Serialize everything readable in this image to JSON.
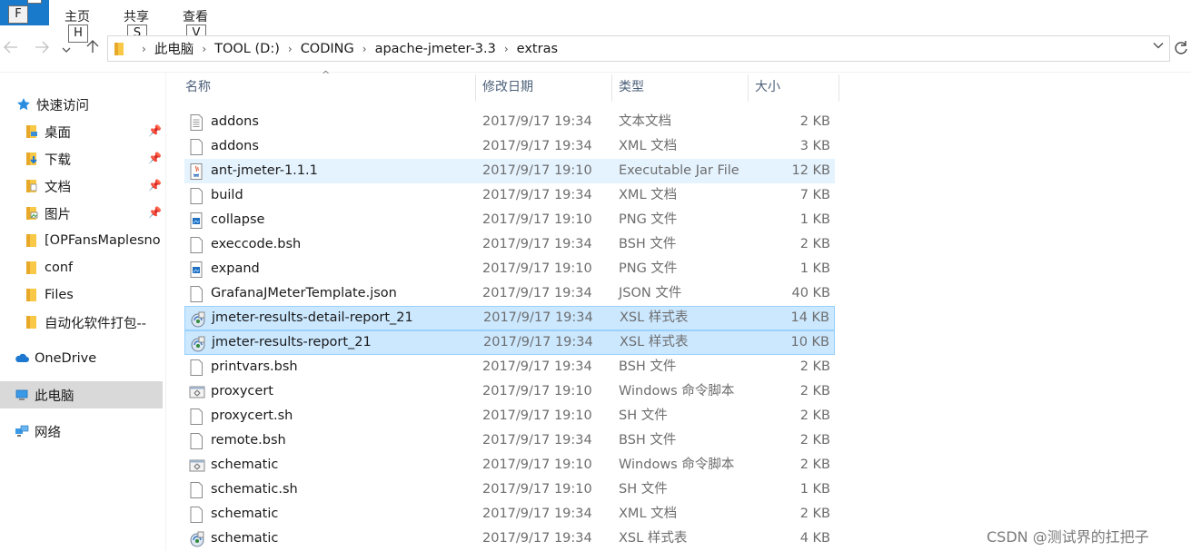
{
  "ribbon": {
    "file_key": "F",
    "tabs": [
      {
        "label": "主页",
        "key": "H"
      },
      {
        "label": "共享",
        "key": "S"
      },
      {
        "label": "查看",
        "key": "V"
      }
    ]
  },
  "address": {
    "crumbs": [
      "此电脑",
      "TOOL (D:)",
      "CODING",
      "apache-jmeter-3.3",
      "extras"
    ]
  },
  "sidebar": {
    "quick_access": "快速访问",
    "items": [
      {
        "label": "桌面",
        "pinned": true,
        "icon": "desktop-folder-icon"
      },
      {
        "label": "下载",
        "pinned": true,
        "icon": "download-folder-icon"
      },
      {
        "label": "文档",
        "pinned": true,
        "icon": "documents-folder-icon"
      },
      {
        "label": "图片",
        "pinned": true,
        "icon": "pictures-folder-icon"
      },
      {
        "label": "[OPFansMaplesno",
        "pinned": false,
        "icon": "folder-icon"
      },
      {
        "label": "conf",
        "pinned": false,
        "icon": "folder-icon"
      },
      {
        "label": "Files",
        "pinned": false,
        "icon": "folder-icon"
      },
      {
        "label": "自动化软件打包--",
        "pinned": false,
        "icon": "folder-icon"
      }
    ],
    "onedrive": "OneDrive",
    "this_pc": "此电脑",
    "network": "网络"
  },
  "columns": {
    "name": "名称",
    "date": "修改日期",
    "type": "类型",
    "size": "大小"
  },
  "files": [
    {
      "name": "addons",
      "date": "2017/9/17 19:34",
      "type": "文本文档",
      "size": "2 KB",
      "icon": "text-file-icon",
      "state": ""
    },
    {
      "name": "addons",
      "date": "2017/9/17 19:34",
      "type": "XML 文档",
      "size": "3 KB",
      "icon": "xml-file-icon",
      "state": ""
    },
    {
      "name": "ant-jmeter-1.1.1",
      "date": "2017/9/17 19:10",
      "type": "Executable Jar File",
      "size": "12 KB",
      "icon": "java-jar-icon",
      "state": "hover"
    },
    {
      "name": "build",
      "date": "2017/9/17 19:34",
      "type": "XML 文档",
      "size": "7 KB",
      "icon": "xml-file-icon",
      "state": ""
    },
    {
      "name": "collapse",
      "date": "2017/9/17 19:10",
      "type": "PNG 文件",
      "size": "1 KB",
      "icon": "png-file-icon",
      "state": ""
    },
    {
      "name": "execcode.bsh",
      "date": "2017/9/17 19:34",
      "type": "BSH 文件",
      "size": "2 KB",
      "icon": "blank-file-icon",
      "state": ""
    },
    {
      "name": "expand",
      "date": "2017/9/17 19:10",
      "type": "PNG 文件",
      "size": "1 KB",
      "icon": "png-file-icon",
      "state": ""
    },
    {
      "name": "GrafanaJMeterTemplate.json",
      "date": "2017/9/17 19:34",
      "type": "JSON 文件",
      "size": "40 KB",
      "icon": "blank-file-icon",
      "state": ""
    },
    {
      "name": "jmeter-results-detail-report_21",
      "date": "2017/9/17 19:34",
      "type": "XSL 样式表",
      "size": "14 KB",
      "icon": "xsl-file-icon",
      "state": "selected"
    },
    {
      "name": "jmeter-results-report_21",
      "date": "2017/9/17 19:34",
      "type": "XSL 样式表",
      "size": "10 KB",
      "icon": "xsl-file-icon",
      "state": "selected"
    },
    {
      "name": "printvars.bsh",
      "date": "2017/9/17 19:34",
      "type": "BSH 文件",
      "size": "2 KB",
      "icon": "blank-file-icon",
      "state": ""
    },
    {
      "name": "proxycert",
      "date": "2017/9/17 19:10",
      "type": "Windows 命令脚本",
      "size": "2 KB",
      "icon": "cmd-script-icon",
      "state": ""
    },
    {
      "name": "proxycert.sh",
      "date": "2017/9/17 19:10",
      "type": "SH 文件",
      "size": "2 KB",
      "icon": "blank-file-icon",
      "state": ""
    },
    {
      "name": "remote.bsh",
      "date": "2017/9/17 19:34",
      "type": "BSH 文件",
      "size": "2 KB",
      "icon": "blank-file-icon",
      "state": ""
    },
    {
      "name": "schematic",
      "date": "2017/9/17 19:10",
      "type": "Windows 命令脚本",
      "size": "2 KB",
      "icon": "cmd-script-icon",
      "state": ""
    },
    {
      "name": "schematic.sh",
      "date": "2017/9/17 19:10",
      "type": "SH 文件",
      "size": "1 KB",
      "icon": "blank-file-icon",
      "state": ""
    },
    {
      "name": "schematic",
      "date": "2017/9/17 19:34",
      "type": "XML 文档",
      "size": "2 KB",
      "icon": "xml-file-icon",
      "state": ""
    },
    {
      "name": "schematic",
      "date": "2017/9/17 19:34",
      "type": "XSL 样式表",
      "size": "4 KB",
      "icon": "xsl-file-icon",
      "state": ""
    }
  ],
  "watermark": "CSDN @测试界的扛把子",
  "colors": {
    "file_tab": "#1979ca",
    "selection": "#cce8ff",
    "selection_border": "#99d1ff",
    "hover": "#e5f3ff",
    "folder": "#f8c846"
  }
}
